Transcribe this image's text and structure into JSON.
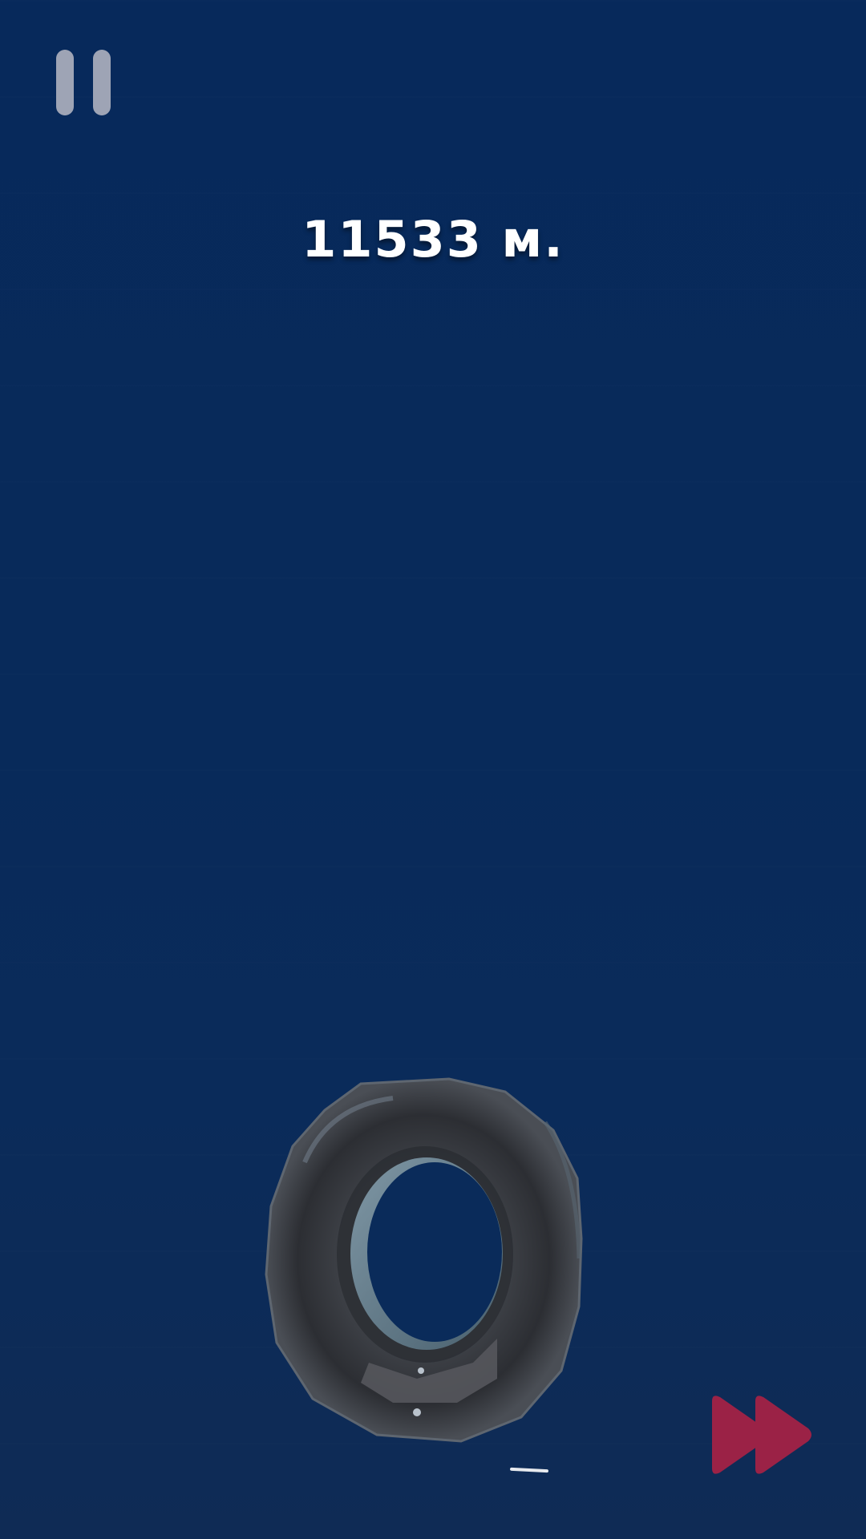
{
  "hud": {
    "distance_text": "11533 м.",
    "pause_icon": "pause-icon",
    "fast_forward_icon": "fast-forward-icon"
  },
  "colors": {
    "background": "#082a5a",
    "pause_icon": "#9ea4b5",
    "fast_forward_icon": "#9b2246",
    "text": "#ffffff"
  },
  "scene": {
    "object": "tire"
  }
}
